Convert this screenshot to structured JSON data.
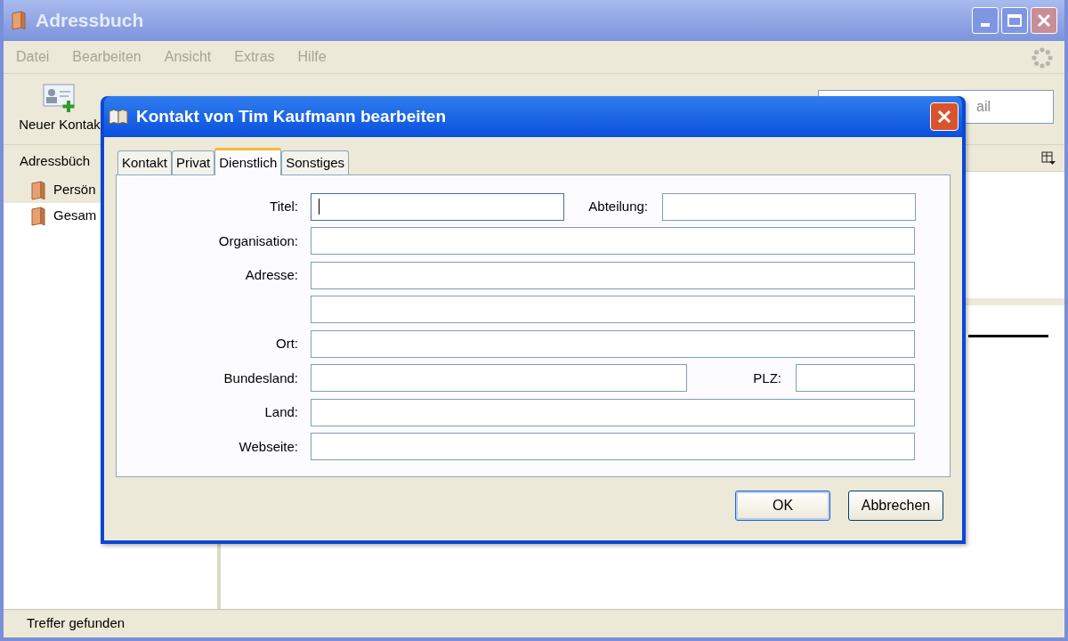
{
  "window": {
    "title": "Adressbuch"
  },
  "menu": [
    {
      "label": "Datei"
    },
    {
      "label": "Bearbeiten"
    },
    {
      "label": "Ansicht"
    },
    {
      "label": "Extras"
    },
    {
      "label": "Hilfe"
    }
  ],
  "toolbar": {
    "new_contact": "Neuer Kontak",
    "search_placeholder": "ail"
  },
  "sidebar": {
    "header": "Adressbüch",
    "items": [
      {
        "label": "Persön",
        "selected": true
      },
      {
        "label": "Gesam",
        "selected": false
      }
    ]
  },
  "status_bar": "Treffer gefunden",
  "dialog": {
    "title": "Kontakt von Tim Kaufmann bearbeiten",
    "tabs": [
      {
        "label": "Kontakt",
        "selected": false
      },
      {
        "label": "Privat",
        "selected": false
      },
      {
        "label": "Dienstlich",
        "selected": true
      },
      {
        "label": "Sonstiges",
        "selected": false
      }
    ],
    "rows": [
      {
        "kind": "split",
        "label": "Titel:",
        "focused": true,
        "extra_label": "Abteilung:"
      },
      {
        "kind": "full",
        "label": "Organisation:",
        "focused": false
      },
      {
        "kind": "full",
        "label": "Adresse:",
        "focused": false
      },
      {
        "kind": "full",
        "focused": false
      },
      {
        "kind": "full",
        "label": "Ort:",
        "focused": false
      },
      {
        "kind": "split_narrow",
        "label": "Bundesland:",
        "focused": false,
        "extra_label": "PLZ:"
      },
      {
        "kind": "full",
        "label": "Land:",
        "focused": false
      },
      {
        "kind": "full",
        "label": "Webseite:",
        "focused": false
      }
    ],
    "buttons": [
      "OK",
      "Abbrechen"
    ]
  }
}
